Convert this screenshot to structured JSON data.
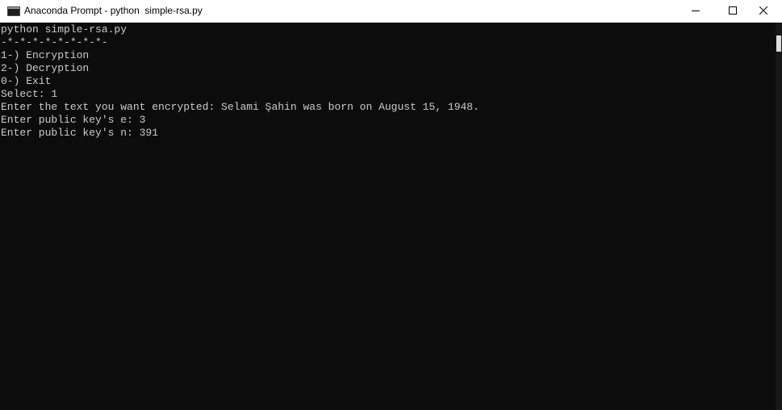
{
  "window": {
    "title": "Anaconda Prompt - python  simple-rsa.py",
    "icon": "console-window-icon",
    "controls": {
      "minimize": "minimize-icon",
      "maximize": "maximize-icon",
      "close": "close-icon"
    }
  },
  "console": {
    "lines": [
      "python simple-rsa.py",
      "-*-*-*-*-*-*-*-*-",
      "1-) Encryption",
      "2-) Decryption",
      "0-) Exit",
      "Select: 1",
      "Enter the text you want encrypted: Selami Şahin was born on August 15, 1948.",
      "Enter public key's e: 3",
      "Enter public key's n: 391"
    ]
  },
  "colors": {
    "background": "#0c0c0c",
    "foreground": "#cccccc",
    "titlebar": "#ffffff"
  }
}
